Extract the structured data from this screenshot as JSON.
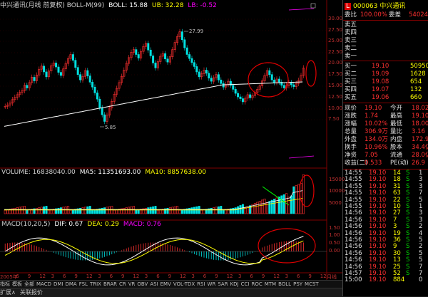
{
  "header": {
    "title": "中兴通讯(月线 前复权) BOLL-M(99)",
    "boll": "BOLL: 15.88",
    "ub": "UB: 32.28",
    "lb": "LB: -0.52"
  },
  "price_axis": [
    "30.00",
    "27.50",
    "25.00",
    "22.50",
    "20.00",
    "17.50",
    "15.00",
    "12.50",
    "10.00",
    "7.50"
  ],
  "annotations": {
    "high": "27.99",
    "low": "5.85"
  },
  "volume_header": {
    "volume": "VOLUME: 16838040.00",
    "ma5": "MA5: 11351693.00",
    "ma10": "MA10: 8857638.00"
  },
  "volume_axis": [
    "15000",
    "10000",
    "5000"
  ],
  "macd_header": {
    "macd": "MACD(10,20,5)",
    "dif": "DIF: 0.67",
    "dea": "DEA: 0.29",
    "macd_val": "MACD: 0.76"
  },
  "macd_axis": [
    "1.50",
    "1.00",
    "0.50",
    "0.00"
  ],
  "time_axis": [
    "2005年",
    "6",
    "9",
    "12",
    "3",
    "6",
    "9",
    "12",
    "3",
    "6",
    "9",
    "12",
    "3",
    "6",
    "9",
    "12",
    "3",
    "6",
    "9",
    "12",
    "3",
    "6",
    "9",
    "12",
    "3",
    "6",
    "9",
    "12",
    "月线"
  ],
  "indicator_tabs": [
    "指标",
    "模板",
    "全部",
    "MACD",
    "DMI",
    "DMA",
    "FSL",
    "TRIX",
    "BRAR",
    "CR",
    "VR",
    "OBV",
    "ASI",
    "EMV",
    "VOL-TDX",
    "RSI",
    "WR",
    "SAR",
    "KDJ",
    "CCI",
    "ROC",
    "MTM",
    "BOLL",
    "PSY",
    "MCST"
  ],
  "footer": [
    "扩展∧",
    "关联报价"
  ],
  "stock": {
    "badge": "L",
    "code": "000063",
    "name": "中兴通讯"
  },
  "weibi": {
    "label1": "委比",
    "val1": "100.00%",
    "label2": "委差",
    "val2": "54024"
  },
  "sell": [
    {
      "label": "卖五"
    },
    {
      "label": "卖四"
    },
    {
      "label": "卖三"
    },
    {
      "label": "卖二"
    },
    {
      "label": "卖一"
    }
  ],
  "buy": [
    {
      "label": "买一",
      "price": "19.10",
      "vol": "50950"
    },
    {
      "label": "买二",
      "price": "19.09",
      "vol": "1628"
    },
    {
      "label": "买三",
      "price": "19.08",
      "vol": "654"
    },
    {
      "label": "买四",
      "price": "19.07",
      "vol": "132"
    },
    {
      "label": "买五",
      "price": "19.06",
      "vol": "660"
    }
  ],
  "quote": [
    {
      "l1": "现价",
      "v1": "19.10",
      "l2": "今开",
      "v2": "18.02"
    },
    {
      "l1": "涨跌",
      "v1": "1.74",
      "l2": "最高",
      "v2": "19.10"
    },
    {
      "l1": "涨幅",
      "v1": "10.02%",
      "l2": "最低",
      "v2": "18.00"
    },
    {
      "l1": "总量",
      "v1": "306.9万",
      "l2": "量比",
      "v2": "3.16"
    },
    {
      "l1": "外盘",
      "v1": "134.0万",
      "l2": "内盘",
      "v2": "172.9万"
    },
    {
      "l1": "换手",
      "v1": "10.96%",
      "l2": "股本",
      "v2": "34.4亿"
    },
    {
      "l1": "净资",
      "v1": "7.05",
      "l2": "流通",
      "v2": "28.0亿"
    },
    {
      "l1": "收益(二)",
      "v1": "0.533",
      "l2": "PE(动)",
      "v2": "26.9"
    }
  ],
  "ticks": [
    {
      "t": "14:55",
      "p": "19.10",
      "v": "14",
      "s": "S",
      "n": "1"
    },
    {
      "t": "14:55",
      "p": "19.10",
      "v": "18",
      "s": "S",
      "n": "3"
    },
    {
      "t": "14:55",
      "p": "19.10",
      "v": "31",
      "s": "S",
      "n": "3"
    },
    {
      "t": "14:55",
      "p": "19.10",
      "v": "63",
      "s": "S",
      "n": "7"
    },
    {
      "t": "14:55",
      "p": "19.10",
      "v": "22",
      "s": "S",
      "n": "5"
    },
    {
      "t": "14:55",
      "p": "19.10",
      "v": "10",
      "s": "S",
      "n": "1"
    },
    {
      "t": "14:56",
      "p": "19.10",
      "v": "27",
      "s": "S",
      "n": "3"
    },
    {
      "t": "14:56",
      "p": "19.10",
      "v": "7",
      "s": "S",
      "n": "3"
    },
    {
      "t": "14:56",
      "p": "19.10",
      "v": "3",
      "s": "S",
      "n": "2"
    },
    {
      "t": "14:56",
      "p": "19.10",
      "v": "19",
      "s": "S",
      "n": "4"
    },
    {
      "t": "14:56",
      "p": "19.10",
      "v": "36",
      "s": "S",
      "n": "5"
    },
    {
      "t": "14:56",
      "p": "19.10",
      "v": "9",
      "s": "S",
      "n": "2"
    },
    {
      "t": "14:56",
      "p": "19.10",
      "v": "30",
      "s": "S",
      "n": "5"
    },
    {
      "t": "14:56",
      "p": "19.10",
      "v": "13",
      "s": "S",
      "n": "5"
    },
    {
      "t": "14:56",
      "p": "19.10",
      "v": "25",
      "s": "S",
      "n": "7"
    },
    {
      "t": "14:57",
      "p": "19.10",
      "v": "52",
      "s": "S",
      "n": "7"
    },
    {
      "t": "15:00",
      "p": "19.10",
      "v": "884",
      "s": "",
      "n": "0"
    }
  ],
  "colors": {
    "up": "#ff3030",
    "down": "#00e0e0",
    "boll": "#ffffff",
    "ma5": "#ffffff",
    "ma10": "#ffff00",
    "dif": "#ffffff",
    "dea": "#ffff00",
    "circle": "#e00000"
  }
}
